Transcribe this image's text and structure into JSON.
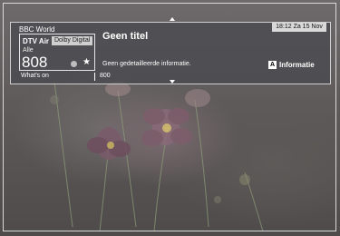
{
  "channel": {
    "name": "BBC World",
    "source": "DTV Air",
    "audio_badge": "Dolby Digital",
    "list": "Alle",
    "number": "808",
    "icons": [
      "dot-icon",
      "star-icon"
    ]
  },
  "program": {
    "title": "Geen titel",
    "description": "Geen gedetailleerde informatie.",
    "next_channel_number": "800"
  },
  "nav": {
    "whats_on": "What's on"
  },
  "clock": {
    "datetime": "18:12 Za 15 Nov"
  },
  "info_button": {
    "key": "A",
    "label": "Informatie"
  },
  "colors": {
    "panel": "#464a4e",
    "badge": "#d9d9d9",
    "text": "#ffffff"
  }
}
